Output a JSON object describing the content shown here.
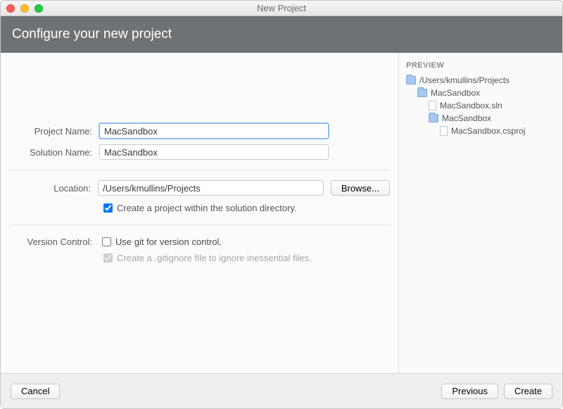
{
  "window": {
    "title": "New Project"
  },
  "header": {
    "title": "Configure your new project"
  },
  "form": {
    "project_name_label": "Project Name:",
    "project_name_value": "MacSandbox",
    "solution_name_label": "Solution Name:",
    "solution_name_value": "MacSandbox",
    "location_label": "Location:",
    "location_value": "/Users/kmullins/Projects",
    "browse_label": "Browse...",
    "create_in_solution_label": "Create a project within the solution directory.",
    "create_in_solution_checked": true,
    "version_control_section_label": "Version Control:",
    "git_checkbox_label": "Use git for version control.",
    "git_checkbox_checked": false,
    "gitignore_checkbox_label": "Create a .gitignore file to ignore inessential files.",
    "gitignore_checkbox_checked": true,
    "gitignore_disabled": true
  },
  "preview": {
    "title": "PREVIEW",
    "root": "/Users/kmullins/Projects",
    "items": [
      {
        "type": "folder",
        "depth": 1,
        "label": "MacSandbox"
      },
      {
        "type": "file",
        "depth": 2,
        "label": "MacSandbox.sln"
      },
      {
        "type": "folder",
        "depth": 2,
        "label": "MacSandbox"
      },
      {
        "type": "file",
        "depth": 3,
        "label": "MacSandbox.csproj"
      }
    ]
  },
  "footer": {
    "cancel": "Cancel",
    "previous": "Previous",
    "create": "Create"
  }
}
